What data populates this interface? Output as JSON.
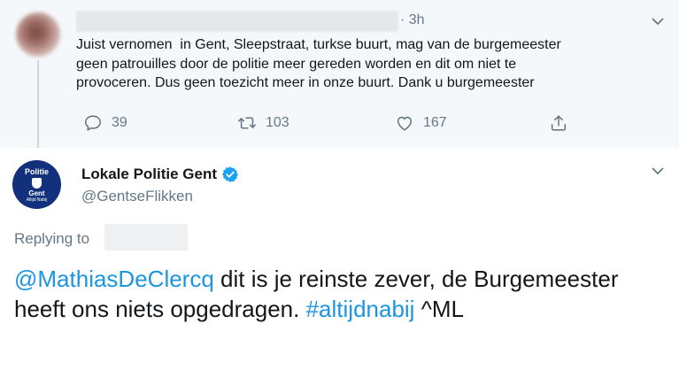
{
  "parent_tweet": {
    "time": "· 3h",
    "text": "Juist vernomen  in Gent, Sleepstraat, turkse buurt, mag van de burgemeester\ngeen patrouilles door de politie meer gereden worden en dit om niet te\nprovoceren. Dus geen toezicht meer in onze buurt. Dank u burgemeester",
    "actions": {
      "reply_count": "39",
      "retweet_count": "103",
      "like_count": "167"
    }
  },
  "main_tweet": {
    "logo": {
      "line1": "Politie",
      "line2": "Gent",
      "line3": "Altijd Nabij"
    },
    "display_name": "Lokale Politie Gent",
    "handle": "@GentseFlikken",
    "replying_to_label": "Replying to",
    "body": {
      "mention": "@MathiasDeClercq",
      "text_part1": " dit is je reinste zever, de Burgemeester heeft ons niets opgedragen. ",
      "hashtag": "#altijdnabij",
      "text_part2": " ^ML"
    }
  },
  "colors": {
    "link": "#1b95e0",
    "secondary_text": "#657786",
    "parent_background": "#f5f8fa",
    "logo_background": "#12307c"
  },
  "icons": [
    "chevron-down-icon",
    "reply-icon",
    "retweet-icon",
    "like-icon",
    "share-icon",
    "verified-icon"
  ]
}
